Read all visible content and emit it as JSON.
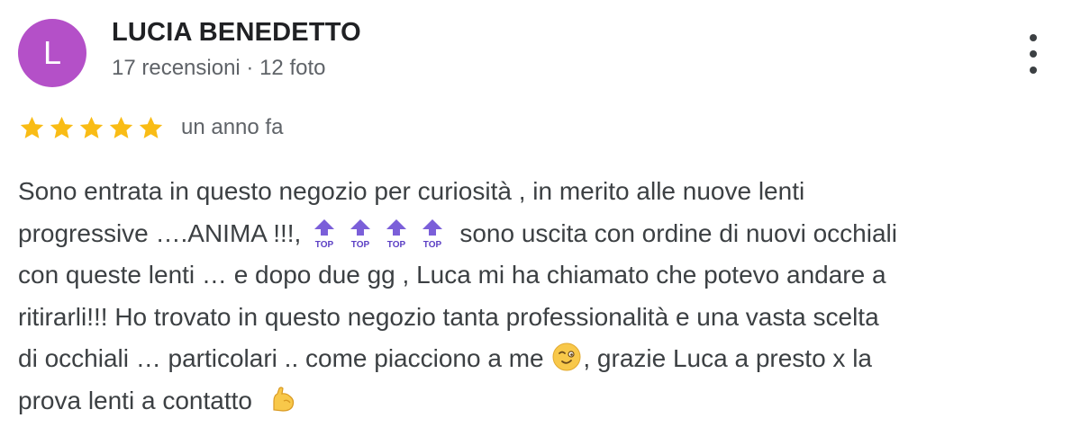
{
  "reviewer": {
    "avatar_letter": "L",
    "avatar_color": "#b450c8",
    "name": "LUCIA BENEDETTO",
    "meta": "17 recensioni · 12 foto"
  },
  "menu": {
    "icon": "more-vert-icon"
  },
  "rating": {
    "stars": 5,
    "max": 5,
    "star_color": "#f9bc15",
    "date": "un anno fa"
  },
  "review": {
    "line1": "Sono entrata in questo negozio per curiosità , in merito alle nuove lenti",
    "line2_start": "progressive ….ANIMA !!!,",
    "line2_end": "sono uscita con ordine di nuovi occhiali",
    "top_emoji_count": 4,
    "top_emoji_label": "TOP",
    "line3": "con queste lenti … e dopo due gg , Luca mi ha chiamato che potevo andare a",
    "line4": "ritirarli!!! Ho trovato in questo negozio tanta professionalità e una vasta scelta",
    "line5_start": "di occhiali … particolari .. come piacciono a me",
    "line5_end": ", grazie Luca a presto x la",
    "line6": "prova lenti a contatto",
    "emojis": [
      "top-arrow-icon",
      "winking-face-icon",
      "flexed-biceps-icon"
    ]
  }
}
